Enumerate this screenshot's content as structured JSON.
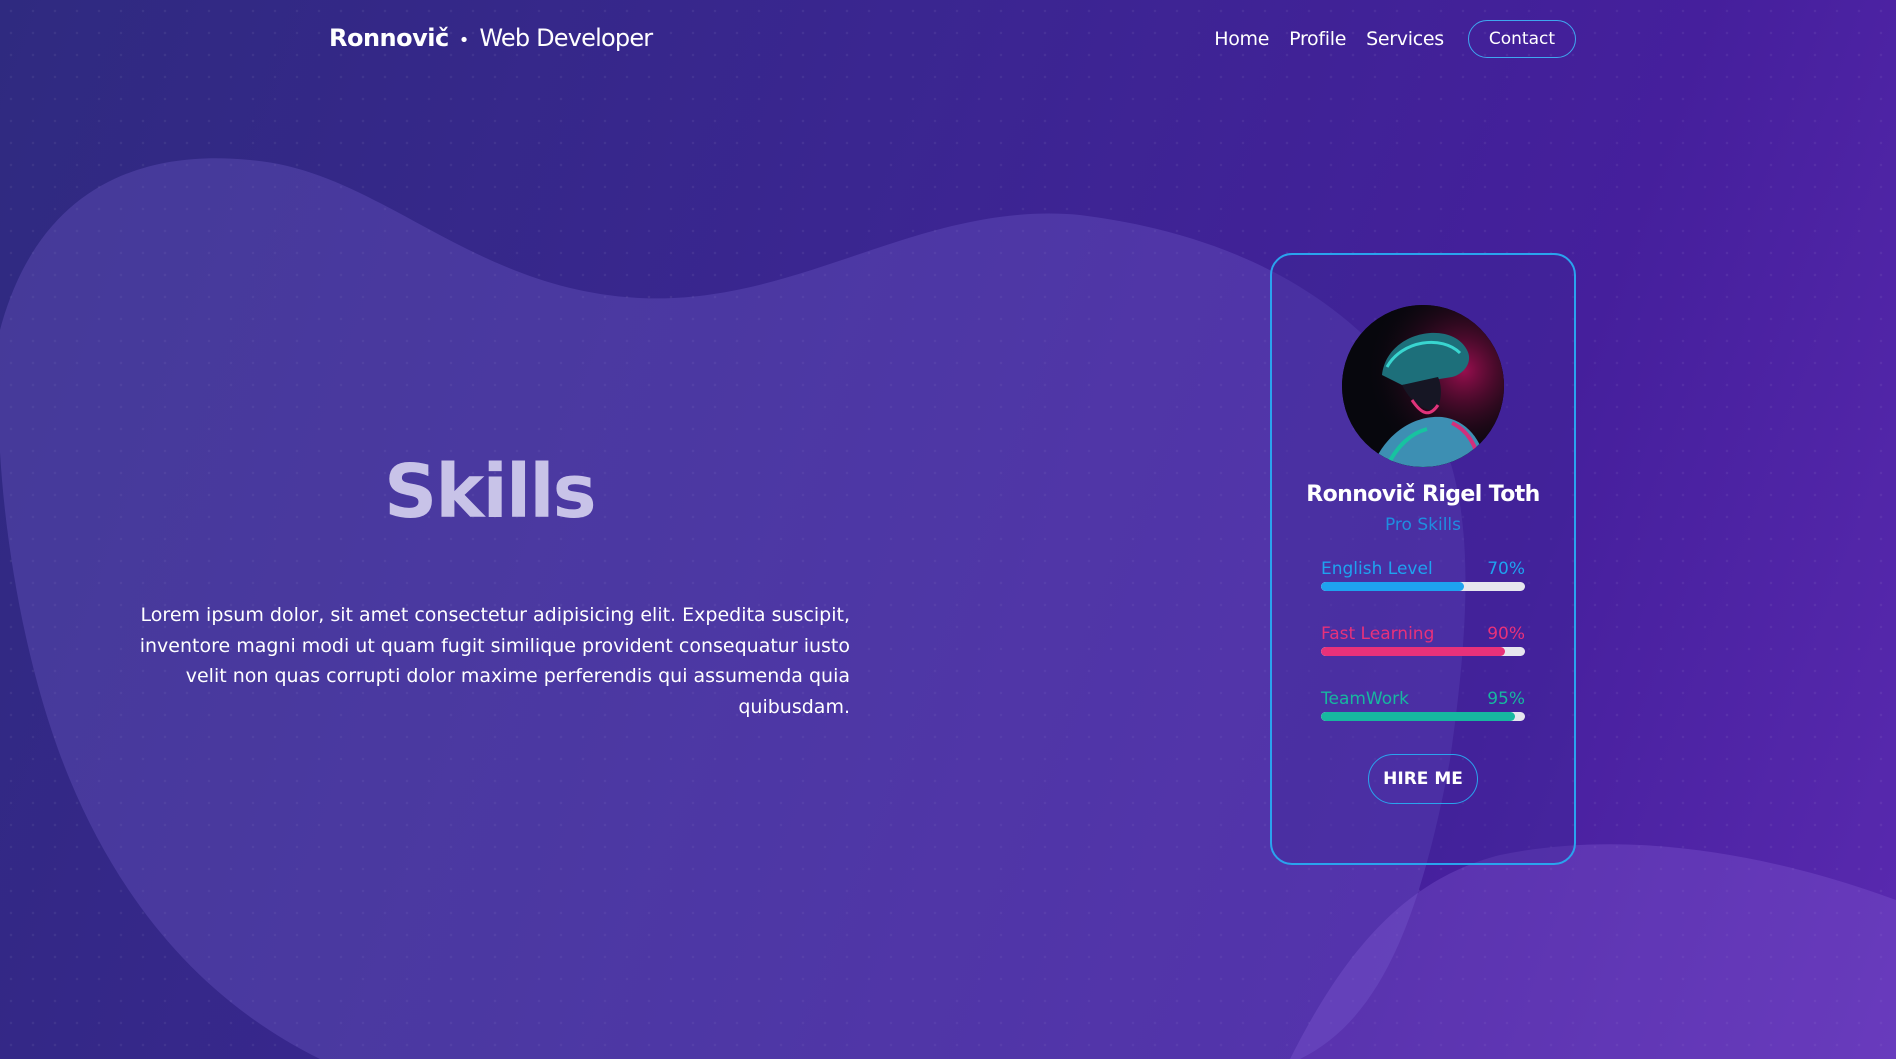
{
  "brand": {
    "name": "Ronnovič",
    "separator": "•",
    "role": "Web Developer"
  },
  "nav": {
    "home": "Home",
    "profile": "Profile",
    "services": "Services",
    "contact": "Contact"
  },
  "hero": {
    "title": "Skills",
    "description": "Lorem ipsum dolor, sit amet consectetur adipisicing elit. Expedita suscipit, inventore magni modi ut quam fugit similique provident consequatur iusto velit non quas corrupti dolor maxime perferendis qui assumenda quia quibusdam."
  },
  "card": {
    "name": "Ronnovič Rigel Toth",
    "subtitle": "Pro Skills",
    "skills": [
      {
        "label": "English Level",
        "percent_text": "70%",
        "value": 70,
        "color": "#1ea3f0"
      },
      {
        "label": "Fast Learning",
        "percent_text": "90%",
        "value": 90,
        "color": "#e8317a"
      },
      {
        "label": "TeamWork",
        "percent_text": "95%",
        "value": 95,
        "color": "#17b7a0"
      }
    ],
    "button": "HIRE ME"
  },
  "colors": {
    "accent_blue": "#2aa3ee",
    "background_start": "#2f2a80",
    "background_end": "#5a2ab0"
  }
}
